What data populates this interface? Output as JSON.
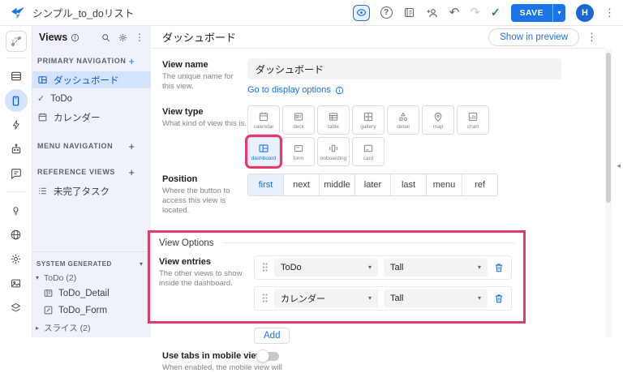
{
  "topbar": {
    "app_title": "シンプル_to_doリスト",
    "save_label": "SAVE",
    "avatar_initial": "H"
  },
  "panel": {
    "title": "Views",
    "primary": {
      "label": "PRIMARY NAVIGATION",
      "items": [
        "ダッシュボード",
        "ToDo",
        "カレンダー"
      ]
    },
    "menu": {
      "label": "MENU NAVIGATION"
    },
    "reference": {
      "label": "REFERENCE VIEWS",
      "items": [
        "未完了タスク"
      ]
    },
    "system": {
      "label": "SYSTEM GENERATED",
      "todo_group": "ToDo (2)",
      "children": [
        "ToDo_Detail",
        "ToDo_Form"
      ],
      "slice_group": "スライス (2)"
    }
  },
  "main": {
    "header_title": "ダッシュボード",
    "preview_button": "Show in preview",
    "view_name": {
      "label": "View name",
      "desc": "The unique name for this view.",
      "value": "ダッシュボード",
      "display_link": "Go to display options"
    },
    "view_type": {
      "label": "View type",
      "desc": "What kind of view this is.",
      "row1": [
        "calendar",
        "deck",
        "table",
        "gallery",
        "detail",
        "map",
        "chart"
      ],
      "row2": [
        "dashboard",
        "form",
        "onboarding",
        "card"
      ],
      "selected": "dashboard"
    },
    "position": {
      "label": "Position",
      "desc": "Where the button to access this view is located.",
      "options": [
        "first",
        "next",
        "middle",
        "later",
        "last",
        "menu",
        "ref"
      ],
      "selected": "first"
    },
    "view_options": {
      "title": "View Options",
      "entries_label": "View entries",
      "entries_desc": "The other views to show inside the dashboard.",
      "entries": [
        {
          "view": "ToDo",
          "size": "Tall"
        },
        {
          "view": "カレンダー",
          "size": "Tall"
        }
      ],
      "add_label": "Add"
    },
    "mobile_tabs": {
      "label": "Use tabs in mobile view",
      "desc": "When enabled, the mobile view will",
      "enabled": false
    }
  },
  "colors": {
    "accent": "#1a73e8",
    "annotation": "#e23a70",
    "selected_bg": "#d2e3fc",
    "check_green": "#1e8e3e"
  }
}
